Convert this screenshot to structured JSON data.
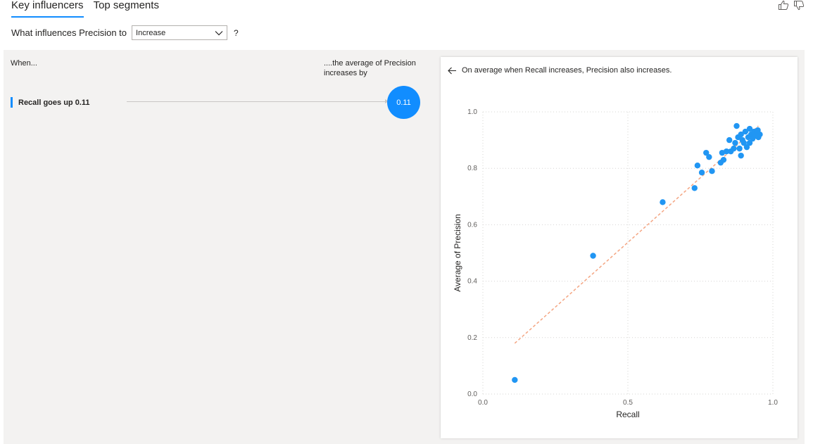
{
  "tabs": [
    {
      "label": "Key influencers",
      "active": true
    },
    {
      "label": "Top segments",
      "active": false
    }
  ],
  "feedback": {
    "like_icon": "thumbs-up-icon",
    "dislike_icon": "thumbs-down-icon"
  },
  "question": {
    "prefix": "What influences Precision to",
    "selected": "Increase",
    "help": "?"
  },
  "influencers_panel": {
    "when_header": "When...",
    "avg_header": "....the average of Precision increases by",
    "items": [
      {
        "label": "Recall goes up 0.11",
        "value": "0.11"
      }
    ]
  },
  "detail": {
    "back_icon": "arrow-left-icon",
    "headline": "On average when Recall increases, Precision also increases."
  },
  "colors": {
    "accent": "#118DFF",
    "point": "#2196F3",
    "trend": "#F4A582"
  },
  "chart_data": {
    "type": "scatter",
    "xlabel": "Recall",
    "ylabel": "Average of Precision",
    "xlim": [
      0,
      1
    ],
    "ylim": [
      0,
      1
    ],
    "xticks": [
      "0.0",
      "0.5",
      "1.0"
    ],
    "yticks": [
      "0.0",
      "0.2",
      "0.4",
      "0.6",
      "0.8",
      "1.0"
    ],
    "grid": true,
    "trendline": {
      "x": [
        0.11,
        0.95
      ],
      "y": [
        0.18,
        0.95
      ]
    },
    "points": [
      {
        "x": 0.11,
        "y": 0.05
      },
      {
        "x": 0.38,
        "y": 0.49
      },
      {
        "x": 0.62,
        "y": 0.68
      },
      {
        "x": 0.73,
        "y": 0.73
      },
      {
        "x": 0.74,
        "y": 0.81
      },
      {
        "x": 0.755,
        "y": 0.785
      },
      {
        "x": 0.77,
        "y": 0.855
      },
      {
        "x": 0.78,
        "y": 0.84
      },
      {
        "x": 0.79,
        "y": 0.79
      },
      {
        "x": 0.82,
        "y": 0.82
      },
      {
        "x": 0.83,
        "y": 0.83
      },
      {
        "x": 0.825,
        "y": 0.855
      },
      {
        "x": 0.84,
        "y": 0.86
      },
      {
        "x": 0.85,
        "y": 0.9
      },
      {
        "x": 0.855,
        "y": 0.86
      },
      {
        "x": 0.865,
        "y": 0.87
      },
      {
        "x": 0.87,
        "y": 0.89
      },
      {
        "x": 0.875,
        "y": 0.95
      },
      {
        "x": 0.88,
        "y": 0.91
      },
      {
        "x": 0.885,
        "y": 0.87
      },
      {
        "x": 0.89,
        "y": 0.845
      },
      {
        "x": 0.89,
        "y": 0.92
      },
      {
        "x": 0.895,
        "y": 0.9
      },
      {
        "x": 0.9,
        "y": 0.89
      },
      {
        "x": 0.905,
        "y": 0.93
      },
      {
        "x": 0.91,
        "y": 0.875
      },
      {
        "x": 0.915,
        "y": 0.91
      },
      {
        "x": 0.92,
        "y": 0.94
      },
      {
        "x": 0.92,
        "y": 0.89
      },
      {
        "x": 0.925,
        "y": 0.92
      },
      {
        "x": 0.93,
        "y": 0.905
      },
      {
        "x": 0.935,
        "y": 0.93
      },
      {
        "x": 0.94,
        "y": 0.915
      },
      {
        "x": 0.945,
        "y": 0.925
      },
      {
        "x": 0.95,
        "y": 0.91
      },
      {
        "x": 0.955,
        "y": 0.92
      },
      {
        "x": 0.948,
        "y": 0.935
      }
    ]
  }
}
